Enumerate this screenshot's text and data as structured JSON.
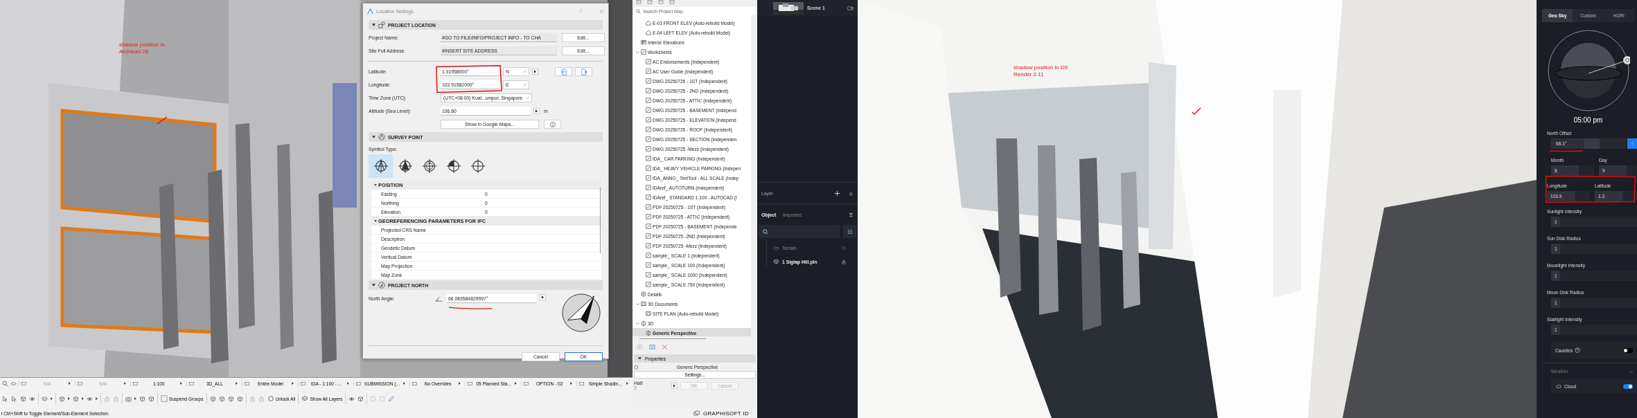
{
  "archicad": {
    "viewport": {
      "kind": "picture",
      "annotation": "shadow position in Archicad 28"
    },
    "dialog": {
      "title": "Location Settings",
      "project_location": {
        "title": "PROJECT LOCATION",
        "expanded": true,
        "project_name": {
          "label": "Project Name:",
          "value": "#GO TO FILE/INFO/PROJECT INFO - TO CHA",
          "button": "Edit..."
        },
        "site_address": {
          "label": "Site Full Address:",
          "value": "#INSERT SITE ADDRESS",
          "button": "Edit..."
        },
        "latitude": {
          "label": "Latitude:",
          "value": "1.31958000°",
          "hemisphere": "N"
        },
        "longitude": {
          "label": "Longitude:",
          "value": "103.91582000°",
          "hemisphere": "E"
        },
        "time_zone": {
          "label": "Time Zone (UTC):",
          "value": "(UTC+08:00) Kual...umpur, Singapore"
        },
        "altitude": {
          "label": "Altitude (Sea Level):",
          "value": "106.80",
          "unit": "m"
        },
        "map_button": "Show in Google Maps..."
      },
      "survey_point": {
        "title": "SURVEY POINT",
        "expanded": true,
        "symbol_label": "Symbol Type:",
        "symbols": [
          {
            "kind": "peaked",
            "selected": true
          },
          {
            "kind": "filled",
            "selected": false
          },
          {
            "kind": "ringed",
            "selected": false
          },
          {
            "kind": "quarter",
            "selected": false
          },
          {
            "kind": "plain",
            "selected": false
          }
        ],
        "groups": [
          {
            "title": "POSITION",
            "expanded": true,
            "rows": [
              {
                "name": "Easting",
                "value": "0"
              },
              {
                "name": "Northing",
                "value": "0"
              },
              {
                "name": "Elevation",
                "value": "0"
              }
            ]
          },
          {
            "title": "GEOREFERENCING PARAMETERS FOR IFC",
            "expanded": true,
            "rows": [
              {
                "name": "Projected CRS Name"
              },
              {
                "name": "Description"
              },
              {
                "name": "Geodetic Datum"
              },
              {
                "name": "Vertical Datum"
              },
              {
                "name": "Map Projection"
              },
              {
                "name": "Map Zone"
              }
            ]
          }
        ]
      },
      "project_north": {
        "title": "PROJECT NORTH",
        "expanded": true,
        "label": "North Angle:",
        "value": "66.083584829997°"
      },
      "buttons": [
        {
          "label": "Cancel",
          "default": false
        },
        {
          "label": "OK",
          "default": true
        }
      ]
    },
    "project_map": {
      "search": {
        "placeholder": "Search Project Map"
      },
      "tree": [
        {
          "children": [
            {
              "label": "E-03 FRONT ELEV (Auto-rebuild Model)",
              "kind": "elevation",
              "selected": false
            },
            {
              "label": "E-04 LEFT ELEV (Auto-rebuild Model)",
              "kind": "elevation",
              "selected": false
            }
          ]
        },
        {
          "label": "Interior Elevations",
          "kind": "interior",
          "selected": false
        },
        {
          "label": "Worksheets",
          "kind": "worksheet",
          "selected": false,
          "expanded": true,
          "children": [
            {
              "label": "AC Endorsements (Independent)",
              "kind": "worksheet",
              "selected": false
            },
            {
              "label": "AC User Guide (Independent)",
              "kind": "worksheet",
              "selected": false
            },
            {
              "label": "DWG 20250725 - 1ST (Independent)",
              "kind": "worksheet",
              "selected": false
            },
            {
              "label": "DWG 20250725 - 2ND (Independent)",
              "kind": "worksheet",
              "selected": false
            },
            {
              "label": "DWG 20250725 - ATTIC (Independent)",
              "kind": "worksheet",
              "selected": false
            },
            {
              "label": "DWG 20250725 - BASEMENT (Independ",
              "kind": "worksheet",
              "selected": false
            },
            {
              "label": "DWG 20250725 - ELEVATION (Independ",
              "kind": "worksheet",
              "selected": false
            },
            {
              "label": "DWG 20250725 - ROOF (Independent)",
              "kind": "worksheet",
              "selected": false
            },
            {
              "label": "DWG 20250725 - SECTION (Independen",
              "kind": "worksheet",
              "selected": false
            },
            {
              "label": "DWG 20250725 -Mezz (Independent)",
              "kind": "worksheet",
              "selected": false
            },
            {
              "label": "IDA_ CAR PARKING (Independent)",
              "kind": "worksheet",
              "selected": false
            },
            {
              "label": "IDA_ HEAVY VEHICLE PARKING (Indepen",
              "kind": "worksheet",
              "selected": false
            },
            {
              "label": "IDA_ANNO_ TextTool - ALL SCALE (Indep",
              "kind": "worksheet",
              "selected": false
            },
            {
              "label": "IDAref_ AUTOTURN (Independent)",
              "kind": "worksheet",
              "selected": false
            },
            {
              "label": "IDAref_ STANDARD 1:100 - AUTOCAD (I",
              "kind": "worksheet",
              "selected": false
            },
            {
              "label": "PDF 20250725 - 1ST (Independent)",
              "kind": "worksheet",
              "selected": false
            },
            {
              "label": "PDF 20250725 - ATTIC (Independent)",
              "kind": "worksheet",
              "selected": false
            },
            {
              "label": "PDF 20250725 - BASEMENT (Independe",
              "kind": "worksheet",
              "selected": false
            },
            {
              "label": "PDF 20250725 -2ND (Independent)",
              "kind": "worksheet",
              "selected": false
            },
            {
              "label": "PDF 20250725 -Mezz (Independent)",
              "kind": "worksheet",
              "selected": false
            },
            {
              "label": "sample_ SCALE 1 (Independent)",
              "kind": "worksheet",
              "selected": false
            },
            {
              "label": "sample_ SCALE 100 (Independent)",
              "kind": "worksheet",
              "selected": false
            },
            {
              "label": "sample_ SCALE 1000 (Independent)",
              "kind": "worksheet",
              "selected": false
            },
            {
              "label": "sample_ SCALE 750 (Independent)",
              "kind": "worksheet",
              "selected": false
            }
          ]
        },
        {
          "label": "Details",
          "kind": "details",
          "selected": false
        },
        {
          "label": "3D Documents",
          "kind": "document3d",
          "selected": false,
          "expanded": true,
          "children": [
            {
              "label": "SITE PLAN (Auto-rebuild Model)",
              "kind": "document3d",
              "selected": false
            }
          ]
        },
        {
          "label": "3D",
          "kind": "view3d",
          "selected": false,
          "expanded": true,
          "children": [
            {
              "label": "Generic Perspective",
              "kind": "view3d",
              "selected": true
            }
          ]
        }
      ],
      "properties": {
        "title": "Properties",
        "expanded": true,
        "view": "Generic Perspective",
        "button": "Settings..."
      },
      "navigator": {
        "scale_label": "Half",
        "scale_value": "2",
        "buttons": [
          {
            "label": "OK",
            "disabled": true
          },
          {
            "label": "Cancel",
            "disabled": true
          }
        ]
      }
    },
    "info_bar": [
      {
        "text": "N/A",
        "disabled": true
      },
      {
        "text": "N/A",
        "disabled": true
      },
      {
        "text": "1:100",
        "disabled": false
      },
      {
        "text": "3D_ALL",
        "disabled": false
      },
      {
        "text": "Entire Model",
        "disabled": false
      },
      {
        "text": "IDA - 1:100 - ...",
        "disabled": false
      },
      {
        "text": "SUBMISSION (...",
        "disabled": false
      },
      {
        "text": "No Overrides",
        "disabled": false
      },
      {
        "text": "05 Planned Sta...",
        "disabled": false
      },
      {
        "text": "OPTION - 02",
        "disabled": false
      },
      {
        "text": "Simple Shadin...",
        "disabled": false
      }
    ],
    "toolbar": {
      "suspend_groups": "Suspend Groups",
      "unlock_all": "Unlock All",
      "show_all_layers": "Show All Layers"
    },
    "status_bar": {
      "message": "l Ctrl+Shift to Toggle Element/Sub-Element Selection.",
      "account": "GRAPHISOFT ID"
    }
  },
  "d5": {
    "scene": {
      "name": "Scene 1"
    },
    "layer": {
      "title": "Layer"
    },
    "tabs": [
      {
        "label": "Object",
        "selected": true
      },
      {
        "label": "Imported",
        "selected": false
      }
    ],
    "objects": [
      {
        "name": "Terrain",
        "kind": "terrain",
        "visible": false,
        "locked": false
      },
      {
        "name": "1 Siglap Hill.pln",
        "kind": "model",
        "visible": true,
        "locked": true
      }
    ],
    "viewport": {
      "kind": "picture",
      "annotation": "shadow position in D5 Render 2.11"
    },
    "sky": {
      "tabs": [
        {
          "label": "Geo Sky",
          "selected": true
        },
        {
          "label": "Custom",
          "selected": false
        },
        {
          "label": "HDRI",
          "selected": false
        }
      ],
      "time": "05:00 pm",
      "north_offset": {
        "label": "North Offset",
        "value": "66.1°",
        "level": 0.55
      },
      "date": [
        {
          "label": "Month",
          "value": "8"
        },
        {
          "label": "Day",
          "value": "9"
        }
      ],
      "location": [
        {
          "label": "Longitude",
          "value": "103.9"
        },
        {
          "label": "Latitude",
          "value": "1.3"
        }
      ],
      "sliders": [
        {
          "label": "Sunlight Intensity",
          "value": "1"
        },
        {
          "label": "Sun Disk Radius",
          "value": "1"
        },
        {
          "label": "Moonlight Intensity",
          "value": "1"
        },
        {
          "label": "Moon Disk Radius",
          "value": "1"
        },
        {
          "label": "Starlight Intensity",
          "value": "1"
        }
      ],
      "caustics": {
        "label": "Caustics",
        "on": false
      },
      "weather": {
        "title": "Weather",
        "expanded": false
      },
      "cloud": {
        "label": "Cloud",
        "on": true
      }
    }
  }
}
